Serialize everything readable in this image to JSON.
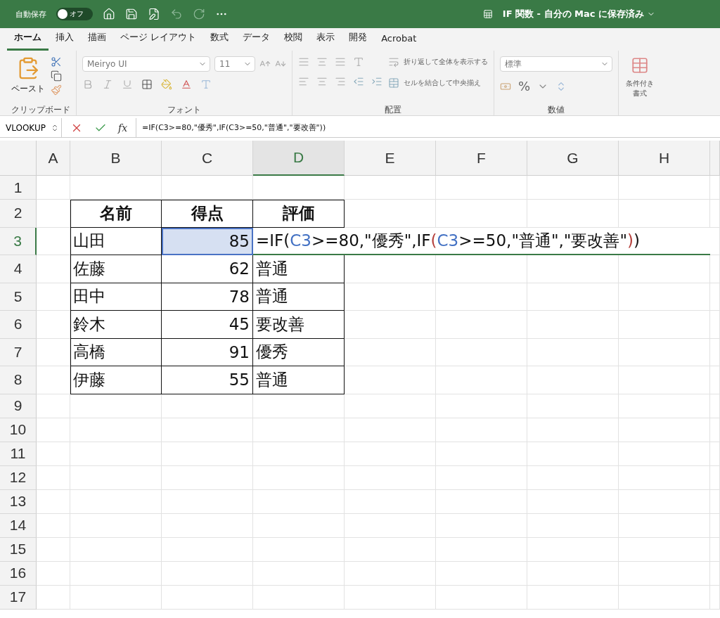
{
  "title_bar": {
    "autosave_label": "自動保存",
    "autosave": {
      "on": false,
      "label": "オフ"
    },
    "document_title": "IF 関数 - 自分の Mac に保存済み"
  },
  "ribbon_tabs": [
    {
      "label": "ホーム",
      "selected": true
    },
    {
      "label": "挿入",
      "selected": false
    },
    {
      "label": "描画",
      "selected": false
    },
    {
      "label": "ページ レイアウト",
      "selected": false
    },
    {
      "label": "数式",
      "selected": false
    },
    {
      "label": "データ",
      "selected": false
    },
    {
      "label": "校閲",
      "selected": false
    },
    {
      "label": "表示",
      "selected": false
    },
    {
      "label": "開発",
      "selected": false
    },
    {
      "label": "Acrobat",
      "selected": false
    }
  ],
  "ribbon": {
    "clipboard": {
      "paste": "ペースト",
      "label": "クリップボード"
    },
    "font": {
      "font_name": "Meiryo UI",
      "font_size": "11",
      "label": "フォント"
    },
    "alignment": {
      "wrap_text": "折り返して全体を表示する",
      "merge_center": "セルを結合して中央揃え",
      "label": "配置"
    },
    "number": {
      "format": "標準",
      "percent": "%",
      "label": "数値"
    },
    "styles": {
      "conditional_formatting": "条件付き書式"
    }
  },
  "formula_bar": {
    "name_box": "VLOOKUP",
    "fx": "fx",
    "formula": "=IF(C3>=80,\"優秀\",IF(C3>=50,\"普通\",\"要改善\"))"
  },
  "sheet": {
    "columns": [
      {
        "label": "A",
        "selected": false
      },
      {
        "label": "B",
        "selected": false
      },
      {
        "label": "C",
        "selected": false
      },
      {
        "label": "D",
        "selected": true
      },
      {
        "label": "E",
        "selected": false
      },
      {
        "label": "F",
        "selected": false
      },
      {
        "label": "G",
        "selected": false
      },
      {
        "label": "H",
        "selected": false
      }
    ],
    "rows": [
      {
        "label": "1",
        "selected": false
      },
      {
        "label": "2",
        "selected": false
      },
      {
        "label": "3",
        "selected": true
      },
      {
        "label": "4",
        "selected": false
      },
      {
        "label": "5",
        "selected": false
      },
      {
        "label": "6",
        "selected": false
      },
      {
        "label": "7",
        "selected": false
      },
      {
        "label": "8",
        "selected": false
      },
      {
        "label": "9",
        "selected": false
      },
      {
        "label": "10",
        "selected": false
      },
      {
        "label": "11",
        "selected": false
      },
      {
        "label": "12",
        "selected": false
      },
      {
        "label": "13",
        "selected": false
      },
      {
        "label": "14",
        "selected": false
      },
      {
        "label": "15",
        "selected": false
      },
      {
        "label": "16",
        "selected": false
      },
      {
        "label": "17",
        "selected": false
      }
    ],
    "table": {
      "header": [
        "名前",
        "得点",
        "評価"
      ],
      "rows": [
        {
          "name": "山田",
          "score": "85",
          "score_highlighted": true,
          "grade": {
            "kind": "editing",
            "segments": [
              {
                "text": "=IF(",
                "kind": "plain"
              },
              {
                "text": "C3",
                "kind": "ref"
              },
              {
                "text": ">=80,\"優秀\",IF",
                "kind": "plain"
              },
              {
                "text": "(",
                "kind": "paren"
              },
              {
                "text": "C3",
                "kind": "ref"
              },
              {
                "text": ">=50,\"普通\",\"要改善\"",
                "kind": "plain"
              },
              {
                "text": ")",
                "kind": "paren"
              },
              {
                "text": ")",
                "kind": "plain"
              }
            ]
          }
        },
        {
          "name": "佐藤",
          "score": "62",
          "score_highlighted": false,
          "grade": {
            "kind": "value",
            "text": "普通"
          }
        },
        {
          "name": "田中",
          "score": "78",
          "score_highlighted": false,
          "grade": {
            "kind": "value",
            "text": "普通"
          }
        },
        {
          "name": "鈴木",
          "score": "45",
          "score_highlighted": false,
          "grade": {
            "kind": "value",
            "text": "要改善"
          }
        },
        {
          "name": "高橋",
          "score": "91",
          "score_highlighted": false,
          "grade": {
            "kind": "value",
            "text": "優秀"
          }
        },
        {
          "name": "伊藤",
          "score": "55",
          "score_highlighted": false,
          "grade": {
            "kind": "value",
            "text": "普通"
          }
        }
      ]
    }
  }
}
